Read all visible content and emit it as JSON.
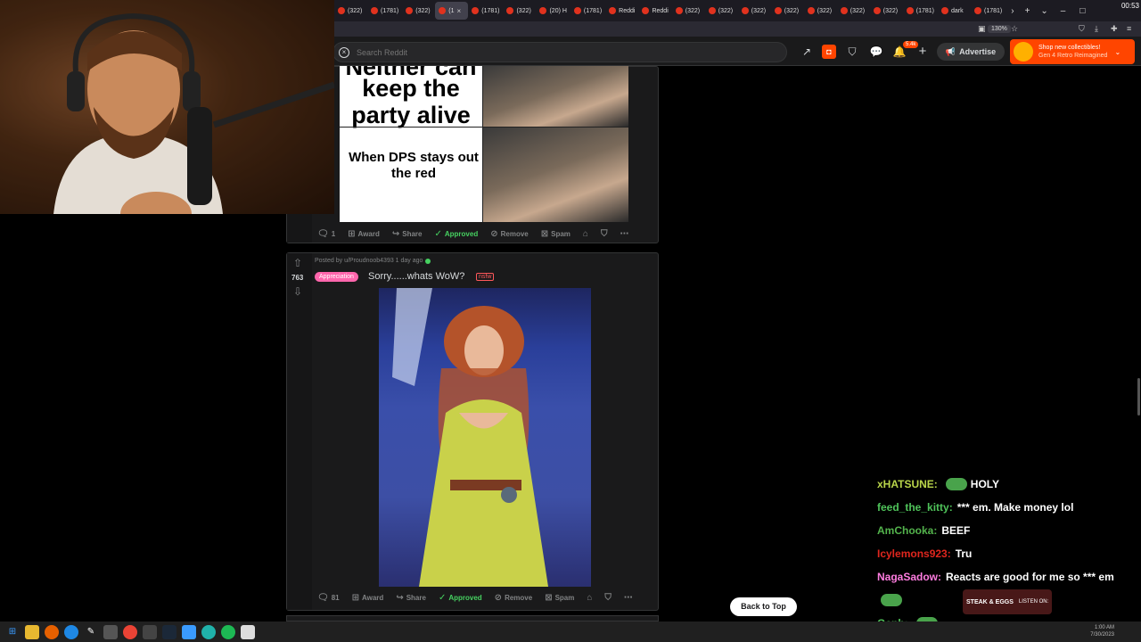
{
  "browser": {
    "tabs": [
      {
        "label": "(322)"
      },
      {
        "label": "(1781)"
      },
      {
        "label": "(322)"
      },
      {
        "label": "(1",
        "active": true
      },
      {
        "label": "(1781)"
      },
      {
        "label": "(322)"
      },
      {
        "label": "(20) H"
      },
      {
        "label": "(1781)"
      },
      {
        "label": "Reddi"
      },
      {
        "label": "Reddi"
      },
      {
        "label": "(322)"
      },
      {
        "label": "(322)"
      },
      {
        "label": "(322)"
      },
      {
        "label": "(322)"
      },
      {
        "label": "(322)"
      },
      {
        "label": "(322)"
      },
      {
        "label": "(322)"
      },
      {
        "label": "(1781)"
      },
      {
        "label": "dark"
      },
      {
        "label": "(1781)"
      }
    ],
    "new_tab": "+",
    "zoom": "130%",
    "clock": "00:53"
  },
  "reddit_header": {
    "search_placeholder": "Search Reddit",
    "notif_count": "5.4k",
    "advertise_label": "Advertise",
    "promo_line1": "Shop new collectibles!",
    "promo_line2": "Gen 4 Retro Reimagined"
  },
  "post1": {
    "meme_top": "keep the party alive",
    "meme_top_partial": "Neither can",
    "meme_bottom": "When DPS stays out the red",
    "comments": "1",
    "award": "Award",
    "share": "Share",
    "approved": "Approved",
    "remove": "Remove",
    "spam": "Spam"
  },
  "post2": {
    "meta": "Posted by u/Proudnoob4393 1 day ago",
    "votes": "763",
    "flair": "Appreciation",
    "title": "Sorry......whats WoW?",
    "nsfw": "nsfw",
    "comments": "81",
    "award": "Award",
    "share": "Share",
    "approved": "Approved",
    "remove": "Remove",
    "spam": "Spam"
  },
  "back_to_top": "Back to Top",
  "chat": [
    {
      "user": "xHATSUNE:",
      "color": "#b9d54a",
      "msg": "HOLY",
      "emote": true
    },
    {
      "user": "feed_the_kitty:",
      "color": "#4fc35a",
      "msg": "*** em. Make money lol",
      "emote": false
    },
    {
      "user": "AmChooka:",
      "color": "#53b34c",
      "msg": "BEEF",
      "emote": false
    },
    {
      "user": "Icylemons923:",
      "color": "#e0261e",
      "msg": "Tru",
      "emote": false
    },
    {
      "user": "NagaSadow:",
      "color": "#ff7de0",
      "msg": "Reacts are good for me so *** em",
      "emote": false
    },
    {
      "user": "",
      "color": "#fff",
      "msg": "",
      "emote": true
    },
    {
      "user": "Genh:",
      "color": "#4fc35a",
      "msg": "",
      "emote": true
    }
  ],
  "podcast": {
    "label1": "STEAK & EGGS",
    "label2": "LISTEN ON:"
  },
  "system_clock": {
    "time": "1:00 AM",
    "date": "7/30/2023"
  }
}
